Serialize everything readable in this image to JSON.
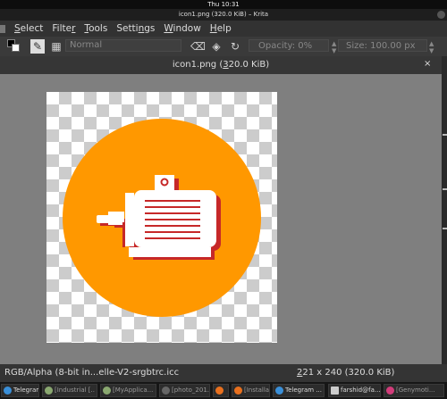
{
  "system": {
    "clock": "Thu 10:31"
  },
  "window": {
    "title": "icon1.png (320.0 KiB) – Krita"
  },
  "menu": {
    "items": [
      {
        "prefix": "",
        "underlined": "S",
        "rest": "elect"
      },
      {
        "prefix": "Filte",
        "underlined": "r",
        "rest": ""
      },
      {
        "prefix": "",
        "underlined": "T",
        "rest": "ools"
      },
      {
        "prefix": "Setti",
        "underlined": "n",
        "rest": "gs"
      },
      {
        "prefix": "",
        "underlined": "W",
        "rest": "indow"
      },
      {
        "prefix": "",
        "underlined": "H",
        "rest": "elp"
      }
    ]
  },
  "toolbar": {
    "blend_mode": "Normal",
    "opacity_label": "Opacity:",
    "opacity_value": "0%",
    "size_label": "Size:",
    "size_value": "100.00 px"
  },
  "document": {
    "tab_prefix": "icon1.png (",
    "tab_underlined": "3",
    "tab_suffix": "20.0 KiB)",
    "close": "×"
  },
  "artwork": {
    "subject": "electric-motor-icon",
    "circle_color": "#ff9800",
    "motor_color": "#ffffff",
    "shadow_color": "#c62828"
  },
  "status": {
    "color_profile": "RGB/Alpha (8-bit in...elle-V2-srgbtrc.icc",
    "dimensions_underlined": "2",
    "dimensions_rest": "21 x 240 (320.0 KiB)"
  },
  "taskbar": {
    "tasks": [
      {
        "label": "Telegram (...",
        "active": true,
        "icon_color": "#3a8fd8"
      },
      {
        "label": "[Industrial [..",
        "active": false,
        "icon_color": "#8aa870"
      },
      {
        "label": "[MyApplica...",
        "active": false,
        "icon_color": "#8aa870"
      },
      {
        "label": "[photo_201...",
        "active": false,
        "icon_color": "#666666"
      },
      {
        "label": "",
        "active": false,
        "icon_color": "#e8701e"
      },
      {
        "label": "[Installatio...",
        "active": false,
        "icon_color": "#e8701e"
      },
      {
        "label": "Telegram ...",
        "active": true,
        "icon_color": "#3a8fd8"
      },
      {
        "label": "farshid@fa...",
        "active": true,
        "icon_color": "#cccccc"
      },
      {
        "label": "[Genymoti...",
        "active": false,
        "icon_color": "#d23c7a"
      }
    ]
  }
}
